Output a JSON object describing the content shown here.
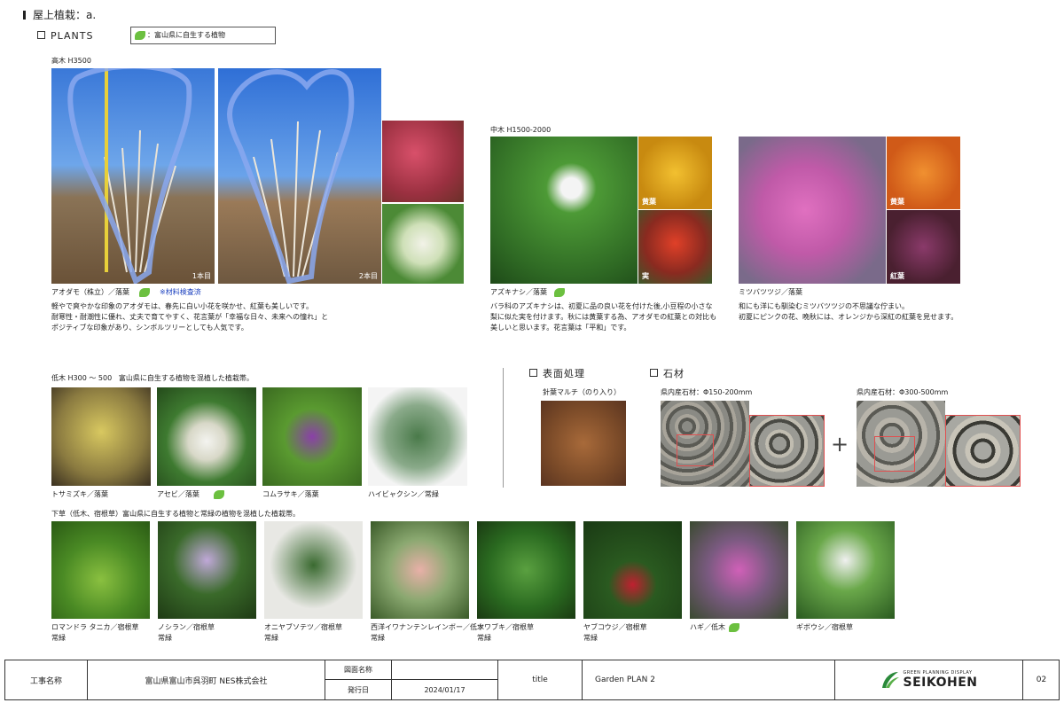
{
  "page_title": "屋上植栽：a.",
  "section_plants": "PLANTS",
  "legend_text": "：富山県に自生する植物",
  "tall": {
    "heading": "高木 H3500",
    "photo1_tag": "1本目",
    "photo2_tag": "2本目",
    "name": "アオダモ（株立）／落葉",
    "note": "※材料検査済",
    "desc": [
      "軽やで爽やかな印象のアオダモは、春先に白い小花を咲かせ、紅葉も美しいです。",
      "耐寒性・耐潮性に優れ、丈夫で育てやすく、花言葉が「幸福な日々、未来への憧れ」と",
      "ポジティブな印象があり、シンボルツリーとしても人気です。"
    ]
  },
  "mid": {
    "heading": "中木 H1500-2000",
    "plant1": {
      "name": "アズキナシ／落葉",
      "tag_a": "黄葉",
      "tag_b": "実",
      "desc": [
        "バラ科のアズキナシは、初夏に品の良い花を付けた後,小豆程の小さな",
        "梨に似た実を付けます。秋には黄葉する為、アオダモの紅葉との対比も",
        "美しいと思います。花言葉は「平和」です。"
      ]
    },
    "plant2": {
      "name": "ミツバツツジ／落葉",
      "tag_a": "黄葉",
      "tag_b": "紅葉",
      "desc": [
        "和にも洋にも馴染むミツバツツジの不思議な佇まい。",
        "初夏にピンクの花、晩秋には、オレンジから深紅の紅葉を見せます。"
      ]
    }
  },
  "low": {
    "heading": "低木 H300 ～ 500",
    "subheading": "富山県に自生する植物を混植した植栽帯。",
    "items": [
      "トサミズキ／落葉",
      "アセビ／落葉",
      "コムラサキ／落葉",
      "ハイビャクシン／常緑"
    ]
  },
  "surface": {
    "heading": "表面処理",
    "item": "針葉マルチ（のり入り）"
  },
  "stone": {
    "heading": "石材",
    "item1": "県内産石材：Φ150-200mm",
    "item2": "県内産石材：Φ300-500mm",
    "plus": "+"
  },
  "ground": {
    "heading": "下草（低木、宿根草）富山県に自生する植物と常緑の植物を混植した植栽帯。",
    "items": [
      {
        "name": "ロマンドラ タニカ／宿根草",
        "sub": "常緑"
      },
      {
        "name": "ノシラン／宿根草",
        "sub": "常緑"
      },
      {
        "name": "オニヤブソテツ／宿根草",
        "sub": "常緑"
      },
      {
        "name": "西洋イワナンテンレインボー／低木",
        "sub": "常緑"
      },
      {
        "name": "ツワブキ／宿根草",
        "sub": "常緑"
      },
      {
        "name": "ヤブコウジ／宿根草",
        "sub": "常緑"
      },
      {
        "name": "ハギ／低木",
        "sub": ""
      },
      {
        "name": "ギボウシ／宿根草",
        "sub": ""
      }
    ]
  },
  "footer": {
    "project_label": "工事名称",
    "project_value": "富山県富山市呉羽町 NES株式会社",
    "drawing_label": "図面名称",
    "drawing_value": "",
    "issue_label": "発行日",
    "issue_value": "2024/01/17",
    "title_label": "title",
    "title_value": "Garden PLAN 2",
    "logo_small": "GREEN PLANNING DISPLAY",
    "logo_big": "SEIKOHEN",
    "page_no": "02"
  },
  "colors": {
    "leaf_icon": "#6cc040",
    "note_blue": "#1a3fbf",
    "outline_blue": "#7f9fe0",
    "frame_red": "#e05050"
  }
}
